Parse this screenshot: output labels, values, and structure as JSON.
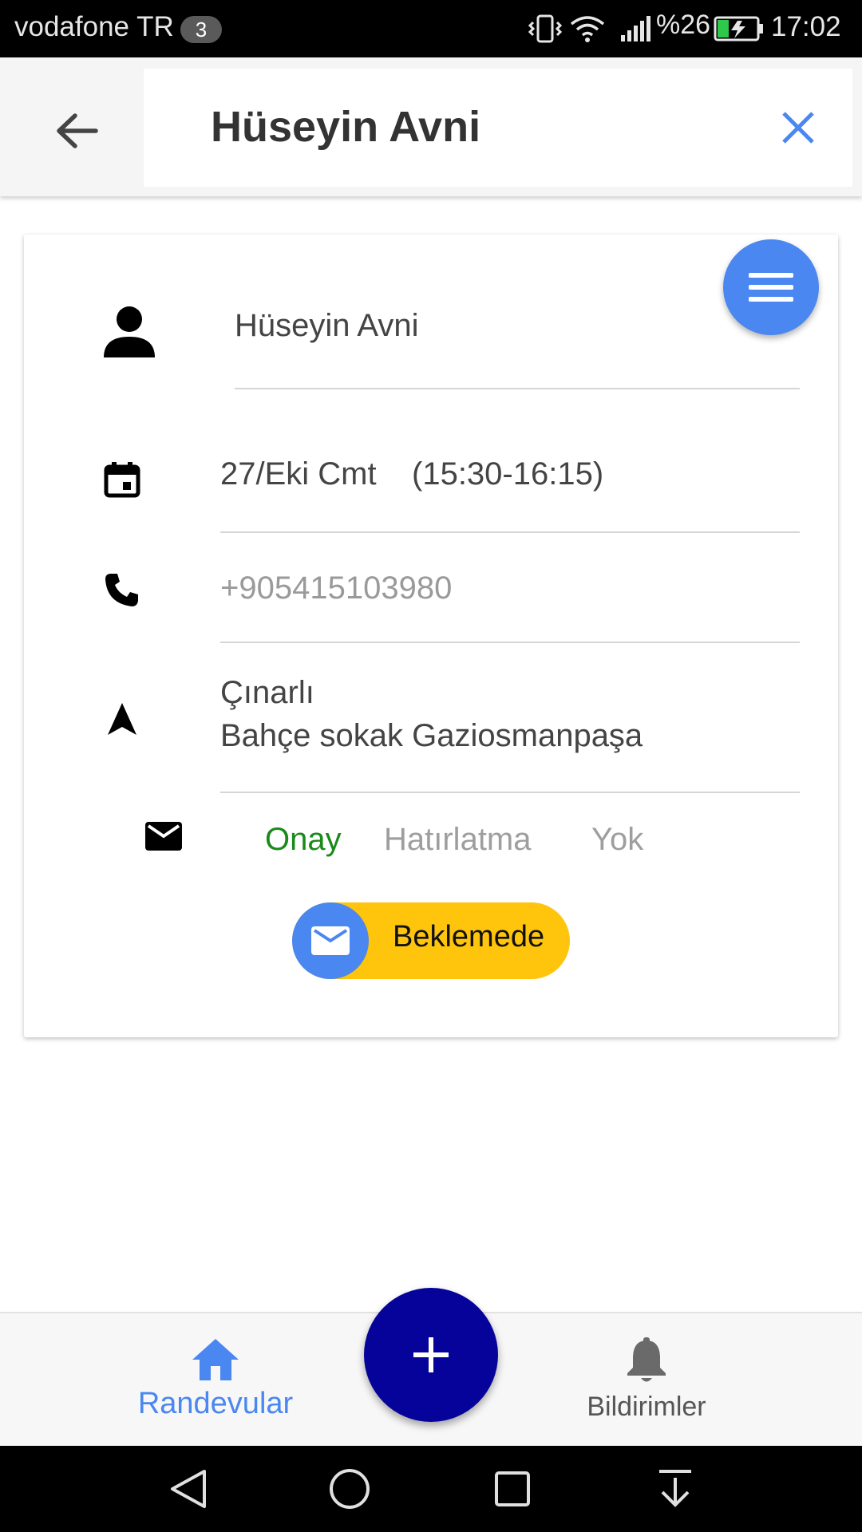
{
  "status_bar": {
    "carrier": "vodafone TR",
    "sim_badge": "3",
    "battery_percent": "%26",
    "time": "17:02",
    "icons": [
      "vibrate-icon",
      "wifi-icon",
      "signal-icon",
      "battery-charging-icon"
    ]
  },
  "header": {
    "title": "Hüseyin Avni",
    "back_icon": "arrow-left-icon",
    "clear_icon": "close-icon"
  },
  "appointment": {
    "name": "Hüseyin Avni",
    "date": "27/Eki Cmt",
    "time_range": "(15:30-16:15)",
    "phone": "+905415103980",
    "address_line1": "Çınarlı",
    "address_line2": "Bahçe sokak Gaziosmanpaşa",
    "sms_options": [
      {
        "label": "Onay",
        "color": "#1a8a1a"
      },
      {
        "label": "Hatırlatma",
        "color": "#9e9e9e"
      },
      {
        "label": "Yok",
        "color": "#9e9e9e"
      }
    ],
    "status": "Beklemede"
  },
  "bottom_nav": {
    "items": [
      {
        "label": "Randevular",
        "icon": "home-icon",
        "active": true
      },
      {
        "label": "Bildirimler",
        "icon": "bell-icon",
        "active": false
      }
    ],
    "fab_icon": "plus-icon"
  },
  "colors": {
    "accent": "#4a87f0",
    "fab": "#06039a",
    "status_pill": "#ffc40c",
    "active_nav": "#4a87f0"
  }
}
